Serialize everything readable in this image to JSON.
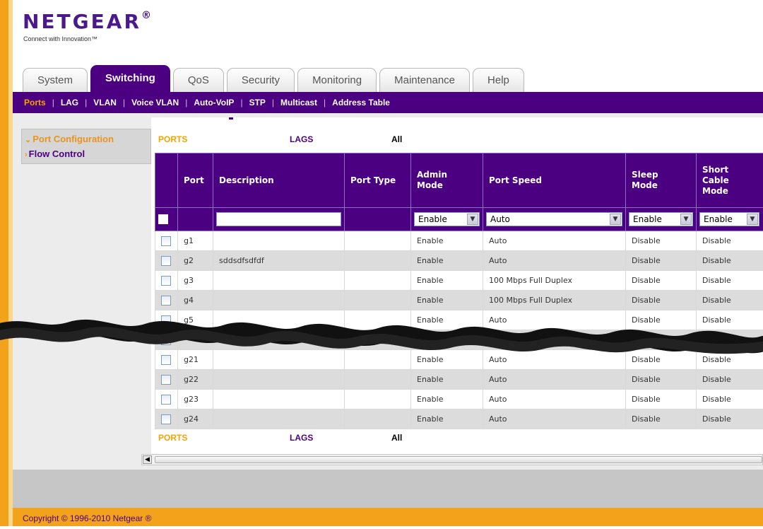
{
  "brand": {
    "logo": "NETGEAR",
    "logo_reg": "®",
    "tagline": "Connect with Innovation™"
  },
  "tabs": [
    {
      "label": "System",
      "active": false
    },
    {
      "label": "Switching",
      "active": true
    },
    {
      "label": "QoS",
      "active": false
    },
    {
      "label": "Security",
      "active": false
    },
    {
      "label": "Monitoring",
      "active": false
    },
    {
      "label": "Maintenance",
      "active": false
    },
    {
      "label": "Help",
      "active": false
    }
  ],
  "subnav": [
    {
      "label": "Ports",
      "active": true
    },
    {
      "label": "LAG",
      "active": false
    },
    {
      "label": "VLAN",
      "active": false
    },
    {
      "label": "Voice VLAN",
      "active": false
    },
    {
      "label": "Auto-VoIP",
      "active": false
    },
    {
      "label": "STP",
      "active": false
    },
    {
      "label": "Multicast",
      "active": false
    },
    {
      "label": "Address Table",
      "active": false
    }
  ],
  "leftnav": [
    {
      "label": "Port Configuration",
      "arrow": "⌄",
      "active": true
    },
    {
      "label": "Flow Control",
      "arrow": "›",
      "active": false
    }
  ],
  "filter": {
    "ports": "PORTS",
    "lags": "LAGS",
    "all": "All"
  },
  "table": {
    "headers": {
      "port": "Port",
      "description": "Description",
      "port_type": "Port Type",
      "admin_mode_1": "Admin",
      "admin_mode_2": "Mode",
      "port_speed": "Port Speed",
      "sleep_mode_1": "Sleep",
      "sleep_mode_2": "Mode",
      "short_cable_1": "Short",
      "short_cable_2": "Cable",
      "short_cable_3": "Mode"
    },
    "input_row": {
      "description": "",
      "admin_mode": "Enable",
      "port_speed": "Auto",
      "sleep_mode": "Enable",
      "short_cable_mode": "Enable"
    },
    "rows": [
      {
        "port": "g1",
        "description": "",
        "port_type": "",
        "admin": "Enable",
        "speed": "Auto",
        "sleep": "Disable",
        "short_cable": "Disable"
      },
      {
        "port": "g2",
        "description": "sddsdfsdfdf",
        "port_type": "",
        "admin": "Enable",
        "speed": "Auto",
        "sleep": "Disable",
        "short_cable": "Disable"
      },
      {
        "port": "g3",
        "description": "",
        "port_type": "",
        "admin": "Enable",
        "speed": "100 Mbps Full Duplex",
        "sleep": "Disable",
        "short_cable": "Disable"
      },
      {
        "port": "g4",
        "description": "",
        "port_type": "",
        "admin": "Enable",
        "speed": "100 Mbps Full Duplex",
        "sleep": "Disable",
        "short_cable": "Disable"
      },
      {
        "port": "g5",
        "description": "",
        "port_type": "",
        "admin": "Enable",
        "speed": "Auto",
        "sleep": "Disable",
        "short_cable": "Disable"
      },
      {
        "port": "",
        "description": "",
        "port_type": "",
        "admin": "",
        "speed": "",
        "sleep": "",
        "short_cable": ""
      },
      {
        "port": "g21",
        "description": "",
        "port_type": "",
        "admin": "Enable",
        "speed": "Auto",
        "sleep": "Disable",
        "short_cable": "Disable"
      },
      {
        "port": "g22",
        "description": "",
        "port_type": "",
        "admin": "Enable",
        "speed": "Auto",
        "sleep": "Disable",
        "short_cable": "Disable"
      },
      {
        "port": "g23",
        "description": "",
        "port_type": "",
        "admin": "Enable",
        "speed": "Auto",
        "sleep": "Disable",
        "short_cable": "Disable"
      },
      {
        "port": "g24",
        "description": "",
        "port_type": "",
        "admin": "Enable",
        "speed": "Auto",
        "sleep": "Disable",
        "short_cable": "Disable"
      }
    ]
  },
  "icons": {
    "dropdown": "chevron-down-icon",
    "scroll_left": "arrow-left-icon"
  },
  "footer": {
    "copyright": "Copyright © 1996-2010 Netgear ®"
  },
  "colors": {
    "brand_purple": "#4b0082",
    "accent_orange": "#f3a21c",
    "active_link": "#f7a300"
  }
}
